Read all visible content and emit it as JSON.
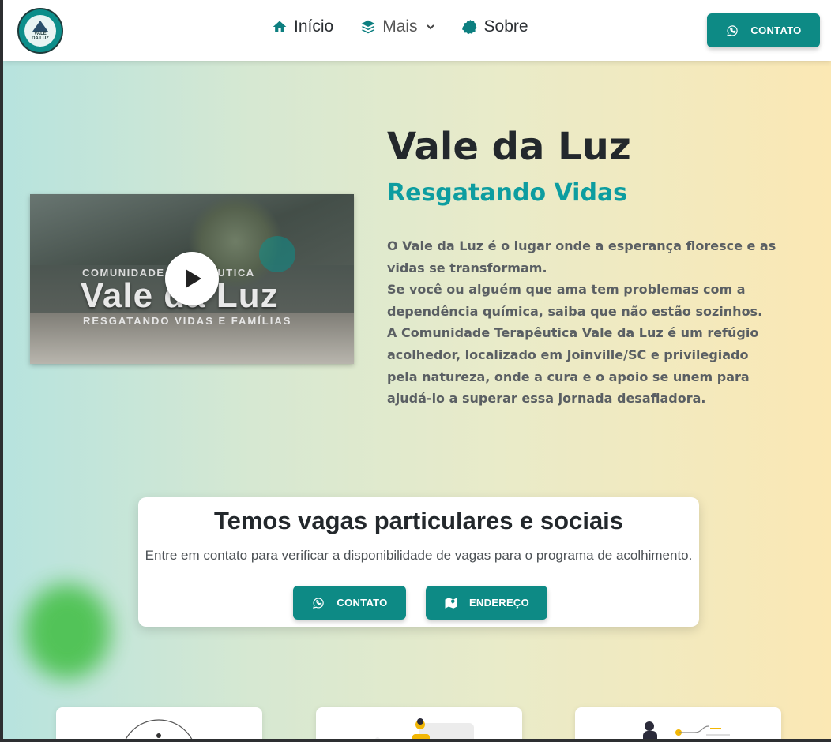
{
  "colors": {
    "accent": "#0d8a85",
    "title": "#23282c",
    "subtitle": "#0d9da0",
    "body_text": "#5a5f63"
  },
  "header": {
    "logo": {
      "text_top": "VALE",
      "text_bottom": "DA LUZ"
    },
    "nav": [
      {
        "label": "Início",
        "icon": "home-icon"
      },
      {
        "label": "Mais",
        "icon": "layers-icon",
        "dropdown": true
      },
      {
        "label": "Sobre",
        "icon": "badge-icon"
      }
    ],
    "contact_button": {
      "label": "CONTATO",
      "icon": "whatsapp-icon"
    }
  },
  "hero": {
    "video": {
      "overlay_small": "COMUNIDADE TERAPÊUTICA",
      "overlay_title": "Vale da Luz",
      "overlay_subtitle": "RESGATANDO VIDAS E FAMÍLIAS",
      "play_icon": "play-icon"
    },
    "title": "Vale da Luz",
    "subtitle": "Resgatando Vidas",
    "paragraphs": [
      "O Vale da Luz é o lugar onde a esperança floresce e as vidas se transformam.",
      "Se você ou alguém que ama tem problemas com a dependência química, saiba que não estão sozinhos.",
      "A Comunidade Terapêutica Vale da Luz é um refúgio acolhedor, localizado em Joinville/SC e privilegiado pela natureza, onde a cura e o apoio se unem para ajudá-lo a superar essa jornada desafiadora."
    ]
  },
  "vagas": {
    "title": "Temos vagas particulares e sociais",
    "description": "Entre em contato para verificar a disponibilidade de vagas para o programa de acolhimento.",
    "contact_button": {
      "label": "CONTATO",
      "icon": "whatsapp-icon"
    },
    "address_button": {
      "label": "ENDEREÇO",
      "icon": "map-icon"
    }
  }
}
